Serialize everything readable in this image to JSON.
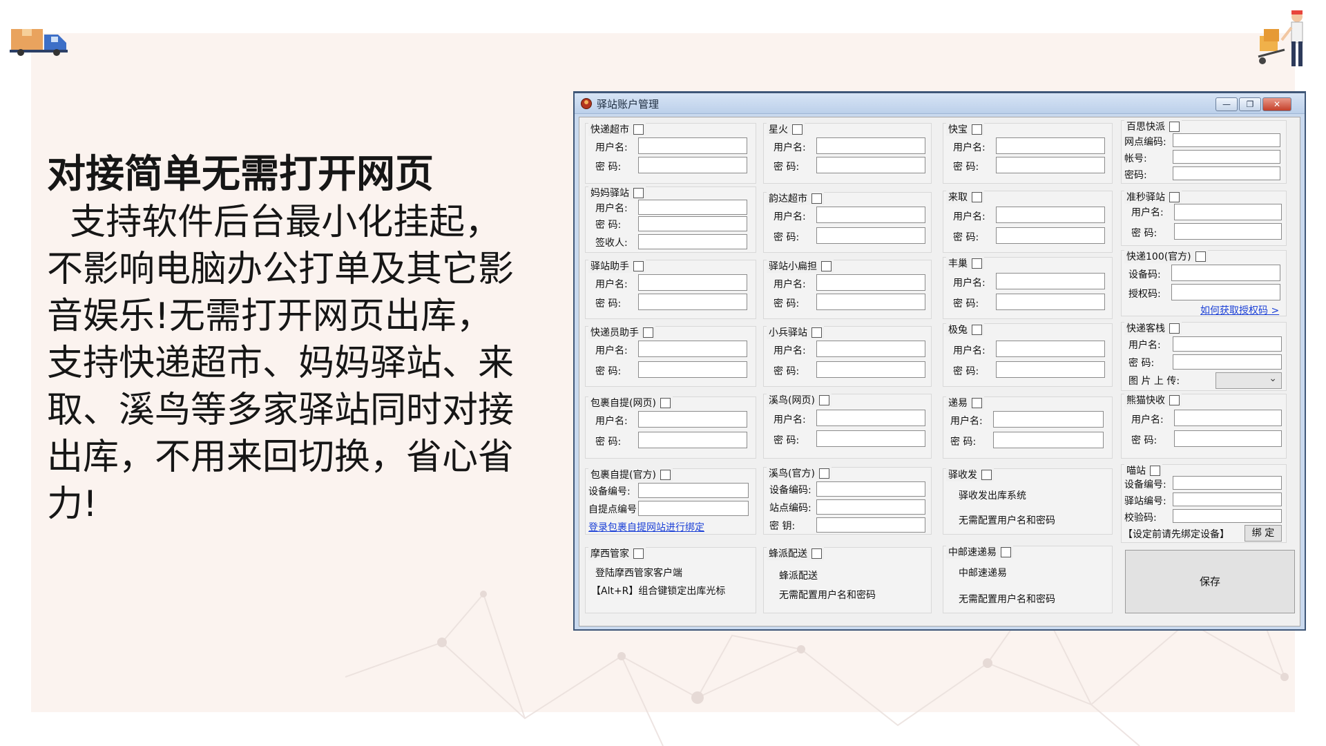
{
  "promo": {
    "title": "对接简单无需打开网页",
    "body": "  支持软件后台最小化挂起，\n不影响电脑办公打单及其它影\n音娱乐!无需打开网页出库，\n支持快递超市、妈妈驿站、来\n取、溪鸟等多家驿站同时对接\n出库，不用来回切换，省心省\n力!"
  },
  "window": {
    "title": "驿站账户管理",
    "min": "—",
    "max": "❐",
    "close": "✕"
  },
  "groups": {
    "kdcs": {
      "title": "快递超市",
      "user": "用户名:",
      "pwd": "密  码:"
    },
    "xh": {
      "title": "星火",
      "user": "用户名:",
      "pwd": "密  码:"
    },
    "kb": {
      "title": "快宝",
      "user": "用户名:",
      "pwd": "密  码:"
    },
    "bs": {
      "title": "百思快派",
      "f1": "网点编码:",
      "f2": "帐号:",
      "f3": "密码:"
    },
    "mm": {
      "title": "妈妈驿站",
      "user": "用户名:",
      "pwd": "密  码:",
      "sign": "签收人:"
    },
    "yd": {
      "title": "韵达超市",
      "user": "用户名:",
      "pwd": "密  码:"
    },
    "lq": {
      "title": "来取",
      "user": "用户名:",
      "pwd": "密  码:"
    },
    "zm": {
      "title": "准秒驿站",
      "user": "用户名:",
      "pwd": "密  码:"
    },
    "yzzs": {
      "title": "驿站助手",
      "user": "用户名:",
      "pwd": "密  码:"
    },
    "yzxm": {
      "title": "驿站小扁担",
      "user": "用户名:",
      "pwd": "密  码:"
    },
    "fc": {
      "title": "丰巢",
      "user": "用户名:",
      "pwd": "密  码:"
    },
    "kd100": {
      "title": "快递100(官方)",
      "dev": "设备码:",
      "auth": "授权码:",
      "link": "如何获取授权码 >"
    },
    "kdyzs": {
      "title": "快递员助手",
      "user": "用户名:",
      "pwd": "密  码:"
    },
    "xbyz": {
      "title": "小兵驿站",
      "user": "用户名:",
      "pwd": "密  码:"
    },
    "jq": {
      "title": "极兔",
      "user": "用户名:",
      "pwd": "密  码:"
    },
    "kdkz": {
      "title": "快递客栈",
      "user": "用户名:",
      "pwd": "密  码:",
      "img": "图 片 上 传:"
    },
    "bgzt": {
      "title": "包裹自提(网页)",
      "user": "用户名:",
      "pwd": "密  码:"
    },
    "xnwy": {
      "title": "溪鸟(网页)",
      "user": "用户名:",
      "pwd": "密  码:"
    },
    "dy": {
      "title": "递易",
      "user": "用户名:",
      "pwd": "密  码:"
    },
    "xmks": {
      "title": "熊猫快收",
      "user": "用户名:",
      "pwd": "密  码:"
    },
    "bgztgf": {
      "title": "包裹自提(官方)",
      "dev": "设备编号:",
      "zt": "自提点编号",
      "link": "登录包裹自提网站进行绑定"
    },
    "xngf": {
      "title": "溪鸟(官方)",
      "dev": "设备编码:",
      "site": "站点编码:",
      "key": "密    钥:"
    },
    "ysf": {
      "title": "驿收发",
      "n1": "驿收发出库系统",
      "n2": "无需配置用户名和密码"
    },
    "mz": {
      "title": "喵站",
      "dev": "设备编号:",
      "site": "驿站编号:",
      "chk": "校验码:",
      "note": "【设定前请先绑定设备】",
      "bind": "绑 定"
    },
    "mxgj": {
      "title": "摩西管家",
      "n1": "登陆摩西管家客户端",
      "n2": "【Alt+R】组合键锁定出库光标"
    },
    "fnps": {
      "title": "蜂派配送",
      "n1": "蜂派配送",
      "n2": "无需配置用户名和密码"
    },
    "zydy": {
      "title": "中邮速递易",
      "n1": "中邮速递易",
      "n2": "无需配置用户名和密码"
    }
  },
  "save": "保存",
  "icons": {
    "truck": "delivery-truck-icon",
    "porter": "delivery-worker-icon"
  },
  "colors": {
    "panel_bg": "#fbf3ef",
    "link": "#1a3fd6",
    "title_bar": "#c9d9ee"
  }
}
